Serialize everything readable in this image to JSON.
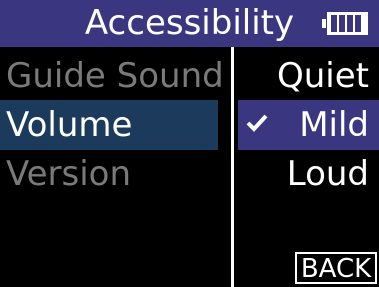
{
  "header": {
    "title": "Accessibility",
    "battery_icon": "battery-icon"
  },
  "left_menu": {
    "items": [
      {
        "label": "Guide Sound",
        "state": "inactive"
      },
      {
        "label": "Volume",
        "state": "selected"
      },
      {
        "label": "Version",
        "state": "inactive"
      }
    ]
  },
  "right_menu": {
    "options": [
      {
        "label": "Quiet"
      },
      {
        "label": "Mild",
        "checked": true
      },
      {
        "label": "Loud"
      }
    ],
    "check_icon": "checkmark-icon"
  },
  "footer": {
    "back_label": "BACK"
  },
  "colors": {
    "header_bg": "#3a3780",
    "left_selected_bg": "#1b3a5c",
    "right_selected_bg": "#3a3780",
    "inactive_text": "#7a7a7a"
  }
}
